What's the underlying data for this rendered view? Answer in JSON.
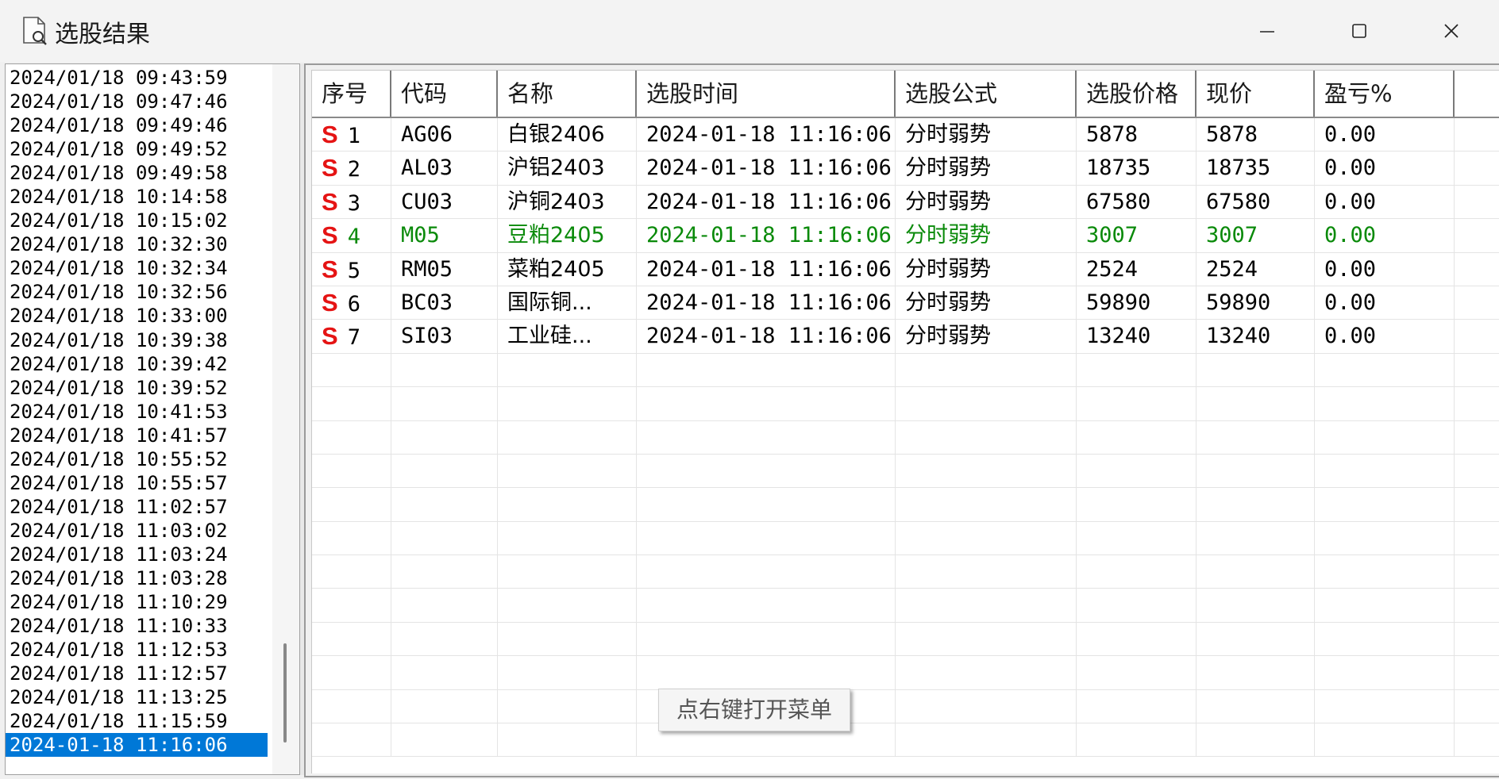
{
  "window": {
    "title": "选股结果",
    "minimize_symbol": "—",
    "maximize_symbol": "☐",
    "close_symbol": "✕"
  },
  "time_list": {
    "items": [
      "2024/01/18 09:43:59",
      "2024/01/18 09:47:46",
      "2024/01/18 09:49:46",
      "2024/01/18 09:49:52",
      "2024/01/18 09:49:58",
      "2024/01/18 10:14:58",
      "2024/01/18 10:15:02",
      "2024/01/18 10:32:30",
      "2024/01/18 10:32:34",
      "2024/01/18 10:32:56",
      "2024/01/18 10:33:00",
      "2024/01/18 10:39:38",
      "2024/01/18 10:39:42",
      "2024/01/18 10:39:52",
      "2024/01/18 10:41:53",
      "2024/01/18 10:41:57",
      "2024/01/18 10:55:52",
      "2024/01/18 10:55:57",
      "2024/01/18 11:02:57",
      "2024/01/18 11:03:02",
      "2024/01/18 11:03:24",
      "2024/01/18 11:03:28",
      "2024/01/18 11:10:29",
      "2024/01/18 11:10:33",
      "2024/01/18 11:12:53",
      "2024/01/18 11:12:57",
      "2024/01/18 11:13:25",
      "2024/01/18 11:15:59"
    ],
    "selected": "2024-01-18 11:16:06"
  },
  "grid": {
    "columns": [
      "序号",
      "代码",
      "名称",
      "选股时间",
      "选股公式",
      "选股价格",
      "现价",
      "盈亏%"
    ],
    "rows": [
      {
        "mark": "S",
        "no": "1",
        "code": "AG06",
        "name": "白银2406",
        "time": "2024-01-18 11:16:06",
        "formula": "分时弱势",
        "sel_price": "5878",
        "cur_price": "5878",
        "pnl": "0.00"
      },
      {
        "mark": "S",
        "no": "2",
        "code": "AL03",
        "name": "沪铝2403",
        "time": "2024-01-18 11:16:06",
        "formula": "分时弱势",
        "sel_price": "18735",
        "cur_price": "18735",
        "pnl": "0.00"
      },
      {
        "mark": "S",
        "no": "3",
        "code": "CU03",
        "name": "沪铜2403",
        "time": "2024-01-18 11:16:06",
        "formula": "分时弱势",
        "sel_price": "67580",
        "cur_price": "67580",
        "pnl": "0.00"
      },
      {
        "mark": "S",
        "no": "4",
        "code": "M05",
        "name": "豆粕2405",
        "time": "2024-01-18 11:16:06",
        "formula": "分时弱势",
        "sel_price": "3007",
        "cur_price": "3007",
        "pnl": "0.00"
      },
      {
        "mark": "S",
        "no": "5",
        "code": "RM05",
        "name": "菜粕2405",
        "time": "2024-01-18 11:16:06",
        "formula": "分时弱势",
        "sel_price": "2524",
        "cur_price": "2524",
        "pnl": "0.00"
      },
      {
        "mark": "S",
        "no": "6",
        "code": "BC03",
        "name": "国际铜...",
        "time": "2024-01-18 11:16:06",
        "formula": "分时弱势",
        "sel_price": "59890",
        "cur_price": "59890",
        "pnl": "0.00"
      },
      {
        "mark": "S",
        "no": "7",
        "code": "SI03",
        "name": "工业硅...",
        "time": "2024-01-18 11:16:06",
        "formula": "分时弱势",
        "sel_price": "13240",
        "cur_price": "13240",
        "pnl": "0.00"
      }
    ],
    "highlight_row": "4",
    "highlight_color": "#0a8a0a",
    "mark_color": "#e51414"
  },
  "hint": {
    "text": "点右键打开菜单"
  }
}
